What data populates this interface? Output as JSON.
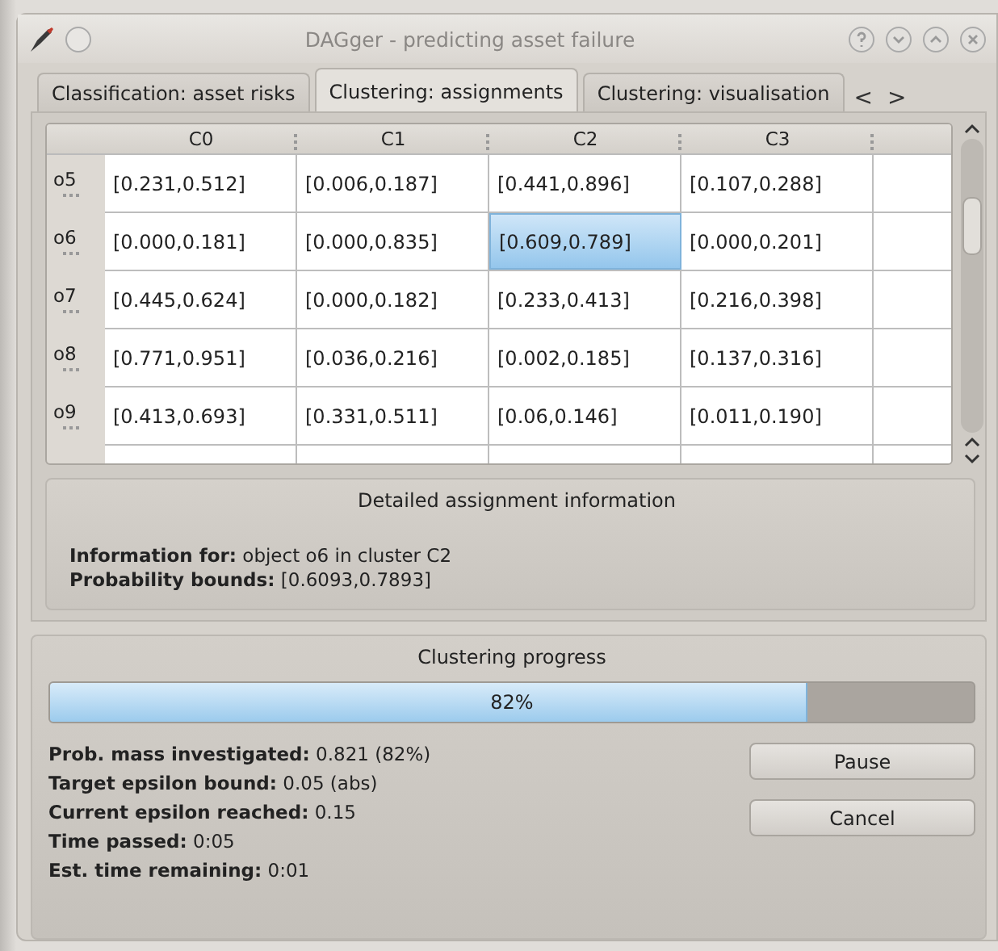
{
  "window": {
    "title": "DAGger - predicting asset failure"
  },
  "tabs": [
    {
      "label": "Classification: asset risks",
      "selected": false
    },
    {
      "label": "Clustering: assignments",
      "selected": true
    },
    {
      "label": "Clustering: visualisation",
      "selected": false
    }
  ],
  "tab_scroll": {
    "left": "<",
    "right": ">"
  },
  "table": {
    "columns": [
      "C0",
      "C1",
      "C2",
      "C3"
    ],
    "rows": [
      {
        "header": "o5",
        "cells": [
          {
            "text": "[0.231,0.512]",
            "selected": false
          },
          {
            "text": "[0.006,0.187]",
            "selected": false
          },
          {
            "text": "[0.441,0.896]",
            "selected": false
          },
          {
            "text": "[0.107,0.288]",
            "selected": false
          }
        ]
      },
      {
        "header": "o6",
        "cells": [
          {
            "text": "[0.000,0.181]",
            "selected": false
          },
          {
            "text": "[0.000,0.835]",
            "selected": false
          },
          {
            "text": "[0.609,0.789]",
            "selected": true
          },
          {
            "text": "[0.000,0.201]",
            "selected": false
          }
        ]
      },
      {
        "header": "o7",
        "cells": [
          {
            "text": "[0.445,0.624]",
            "selected": false
          },
          {
            "text": "[0.000,0.182]",
            "selected": false
          },
          {
            "text": "[0.233,0.413]",
            "selected": false
          },
          {
            "text": "[0.216,0.398]",
            "selected": false
          }
        ]
      },
      {
        "header": "o8",
        "cells": [
          {
            "text": "[0.771,0.951]",
            "selected": false
          },
          {
            "text": "[0.036,0.216]",
            "selected": false
          },
          {
            "text": "[0.002,0.185]",
            "selected": false
          },
          {
            "text": "[0.137,0.316]",
            "selected": false
          }
        ]
      },
      {
        "header": "o9",
        "cells": [
          {
            "text": "[0.413,0.693]",
            "selected": false
          },
          {
            "text": "[0.331,0.511]",
            "selected": false
          },
          {
            "text": "[0.06,0.146]",
            "selected": false
          },
          {
            "text": "[0.011,0.190]",
            "selected": false
          }
        ]
      }
    ]
  },
  "details": {
    "title": "Detailed assignment information",
    "lines": [
      "**Information for:** object o6 in cluster C2",
      "**Probability bounds:** [0.6093,0.7893]"
    ]
  },
  "progress": {
    "title": "Clustering progress",
    "level": 0.82,
    "reading": "82%",
    "stats": [
      "**Prob. mass investigated:** 0.821 (82%)",
      "**Target epsilon bound:** 0.05 (abs)",
      "**Current epsilon reached:** 0.15",
      "**Time passed:** 0:05",
      "**Est. time remaining:** 0:01"
    ],
    "buttons": [
      "Pause",
      "Cancel"
    ]
  }
}
